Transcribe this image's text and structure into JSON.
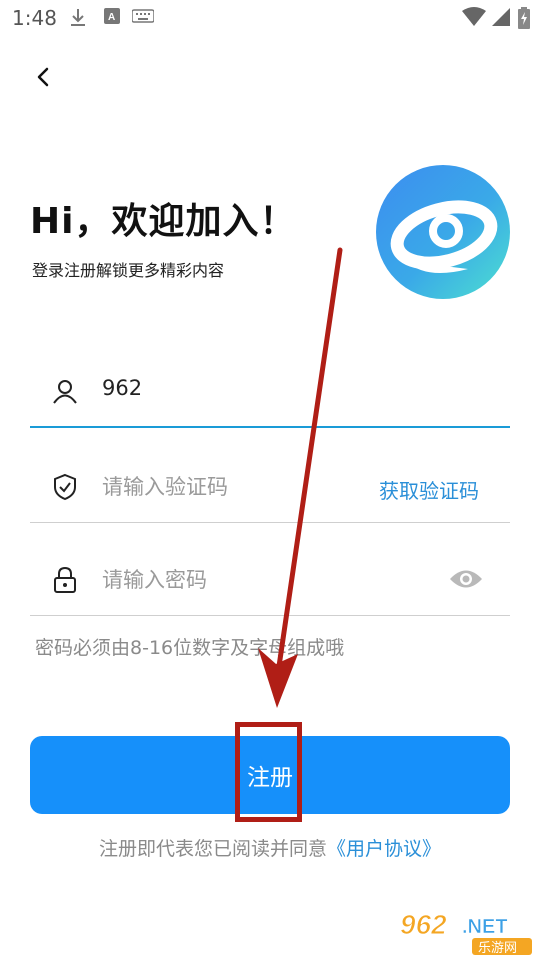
{
  "status_bar": {
    "time": "1:48"
  },
  "greeting": "Hi，欢迎加入！",
  "subtitle": "登录注册解锁更多精彩内容",
  "fields": {
    "phone_value": "962",
    "code_placeholder": "请输入验证码",
    "get_code_label": "获取验证码",
    "password_placeholder": "请输入密码"
  },
  "password_hint": "密码必须由8-16位数字及字母组成哦",
  "register_label": "注册",
  "agreement": {
    "text": "注册即代表您已阅读并同意",
    "link": "《用户协议》"
  },
  "watermark": {
    "brand": "962.NET",
    "sub": "乐游网"
  },
  "colors": {
    "accent": "#1690fa",
    "link": "#2a8fd8",
    "annotation": "#b01e16"
  }
}
